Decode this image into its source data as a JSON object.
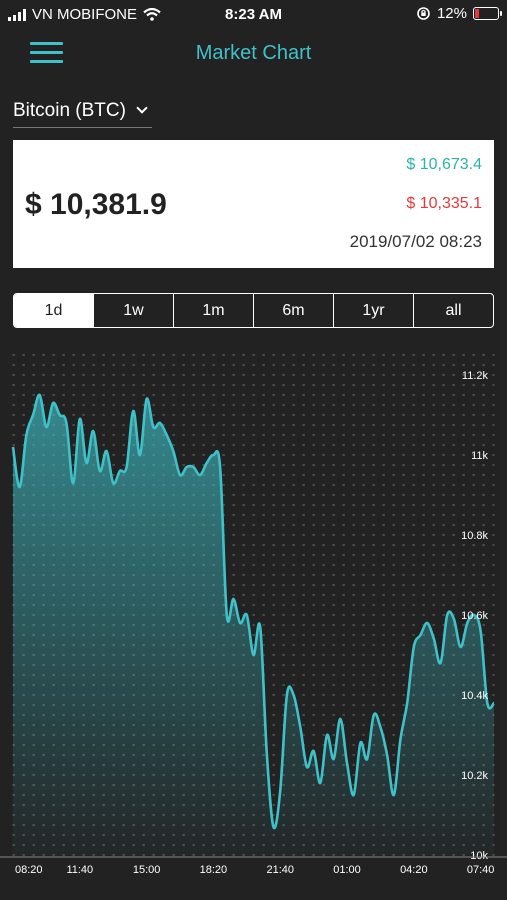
{
  "status": {
    "carrier": "VN MOBIFONE",
    "time": "8:23 AM",
    "battery": "12%"
  },
  "header": {
    "title": "Market Chart"
  },
  "coin": {
    "label": "Bitcoin (BTC)"
  },
  "price": {
    "current": "$ 10,381.9",
    "high": "$ 10,673.4",
    "low": "$ 10,335.1",
    "timestamp": "2019/07/02 08:23"
  },
  "tabs": [
    {
      "label": "1d",
      "active": true
    },
    {
      "label": "1w",
      "active": false
    },
    {
      "label": "1m",
      "active": false
    },
    {
      "label": "6m",
      "active": false
    },
    {
      "label": "1yr",
      "active": false
    },
    {
      "label": "all",
      "active": false
    }
  ],
  "colors": {
    "accent": "#3fc1c9",
    "up": "#2ab3a6",
    "down": "#e53935"
  },
  "chart_data": {
    "type": "area",
    "ylim": [
      10000,
      11250
    ],
    "y_ticks": [
      "11.2k",
      "11k",
      "10.8k",
      "10.6k",
      "10.4k",
      "10.2k",
      "10k"
    ],
    "y_tick_values": [
      11200,
      11000,
      10800,
      10600,
      10400,
      10200,
      10000
    ],
    "x_ticks": [
      "08:20",
      "11:40",
      "15:00",
      "18:20",
      "21:40",
      "01:00",
      "04:20",
      "07:40"
    ],
    "x_tick_values": [
      0,
      200,
      400,
      600,
      800,
      1000,
      1200,
      1400
    ],
    "grid": true,
    "series": [
      {
        "x": [
          0,
          20,
          40,
          60,
          80,
          100,
          120,
          140,
          160,
          180,
          200,
          220,
          240,
          260,
          280,
          300,
          320,
          340,
          360,
          380,
          400,
          420,
          440,
          460,
          480,
          500,
          520,
          540,
          560,
          580,
          600,
          620,
          640,
          660,
          680,
          700,
          720,
          740,
          760,
          780,
          800,
          820,
          840,
          860,
          880,
          900,
          920,
          940,
          960,
          980,
          1000,
          1020,
          1040,
          1060,
          1080,
          1100,
          1120,
          1140,
          1160,
          1180,
          1200,
          1220,
          1240,
          1260,
          1280,
          1300,
          1320,
          1340,
          1360,
          1380,
          1400,
          1420,
          1440
        ],
        "values": [
          11020,
          10920,
          11050,
          11100,
          11150,
          11070,
          11130,
          11100,
          11080,
          10930,
          11090,
          10980,
          11060,
          10960,
          11010,
          10930,
          10960,
          10970,
          11110,
          11000,
          11140,
          11070,
          11080,
          11050,
          11010,
          10950,
          10970,
          10970,
          10950,
          10980,
          11000,
          10970,
          10600,
          10640,
          10580,
          10600,
          10500,
          10570,
          10250,
          10070,
          10160,
          10400,
          10400,
          10320,
          10220,
          10260,
          10180,
          10300,
          10240,
          10340,
          10230,
          10150,
          10280,
          10240,
          10350,
          10320,
          10250,
          10150,
          10290,
          10380,
          10520,
          10550,
          10580,
          10540,
          10480,
          10600,
          10590,
          10520,
          10580,
          10600,
          10560,
          10380,
          10380
        ]
      }
    ]
  }
}
